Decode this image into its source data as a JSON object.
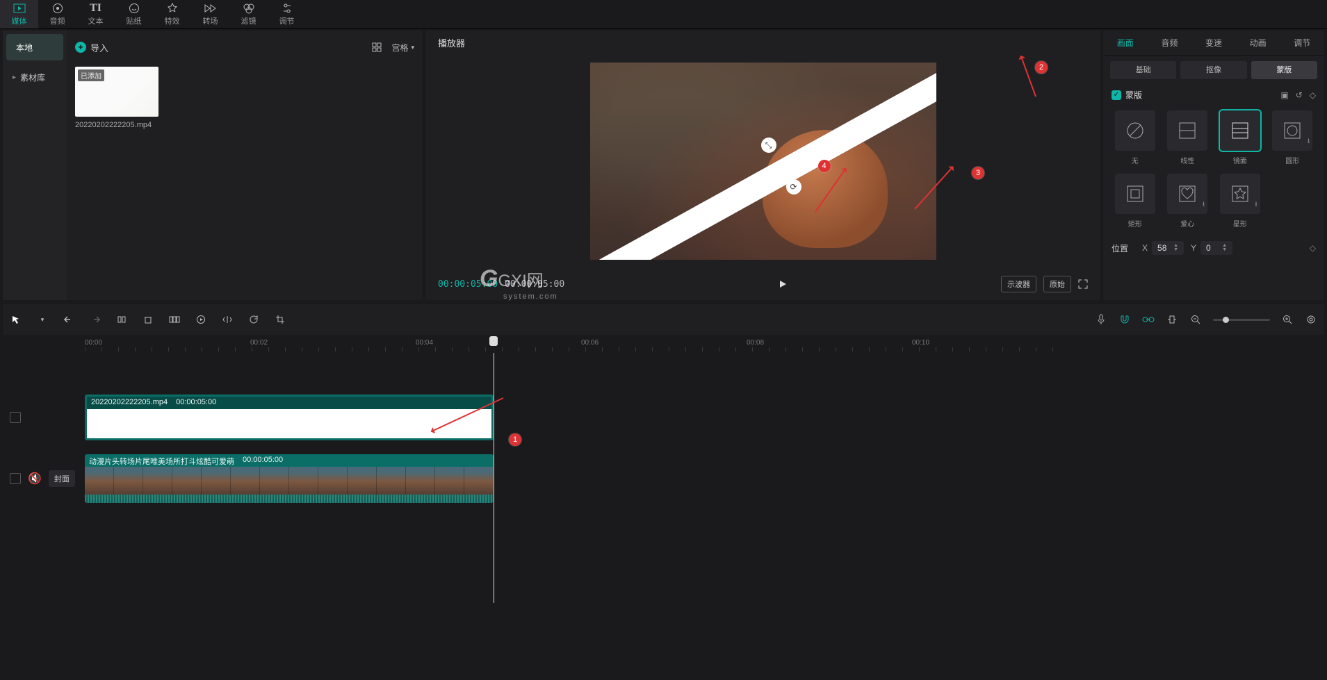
{
  "top_nav": {
    "items": [
      {
        "label": "媒体",
        "icon": "media"
      },
      {
        "label": "音频",
        "icon": "audio"
      },
      {
        "label": "文本",
        "icon": "text"
      },
      {
        "label": "贴纸",
        "icon": "sticker"
      },
      {
        "label": "特效",
        "icon": "effect"
      },
      {
        "label": "转场",
        "icon": "transition"
      },
      {
        "label": "滤镜",
        "icon": "filter"
      },
      {
        "label": "调节",
        "icon": "adjust"
      }
    ],
    "active": 0
  },
  "media_panel": {
    "sidebar": {
      "items": [
        {
          "label": "本地"
        },
        {
          "label": "素材库"
        }
      ],
      "active": 0
    },
    "import_label": "导入",
    "view_label": "宫格",
    "thumb": {
      "badge": "已添加",
      "name": "20220202222205.mp4"
    }
  },
  "player": {
    "title": "播放器",
    "time_current": "00:00:05:00",
    "time_total": "00:00:05:00",
    "scopes_label": "示波器",
    "original_label": "原始"
  },
  "inspector": {
    "tabs": [
      "画面",
      "音频",
      "变速",
      "动画",
      "调节"
    ],
    "active_tab": 0,
    "subtabs": [
      "基础",
      "抠像",
      "蒙版"
    ],
    "active_subtab": 2,
    "mask_title": "蒙版",
    "masks": [
      {
        "label": "无",
        "shape": "none"
      },
      {
        "label": "线性",
        "shape": "linear"
      },
      {
        "label": "镜面",
        "shape": "mirror",
        "selected": true
      },
      {
        "label": "圆形",
        "shape": "circle",
        "dl": true
      },
      {
        "label": "矩形",
        "shape": "rect"
      },
      {
        "label": "爱心",
        "shape": "heart",
        "dl": true
      },
      {
        "label": "星形",
        "shape": "star",
        "dl": true
      }
    ],
    "position": {
      "label": "位置",
      "x_label": "X",
      "x_value": "58",
      "y_label": "Y",
      "y_value": "0"
    }
  },
  "timeline": {
    "ruler_ticks": [
      "00:00",
      "00:02",
      "00:04",
      "00:06",
      "00:08",
      "00:10"
    ],
    "clip1": {
      "name": "20220202222205.mp4",
      "dur": "00:00:05:00"
    },
    "clip2": {
      "name": "动漫片头转场片尾唯美场所打斗炫酷可爱萌",
      "dur": "00:00:05:00"
    },
    "cover_label": "封面"
  },
  "annotations": {
    "a1": "1",
    "a2": "2",
    "a3": "3",
    "a4": "4"
  },
  "watermark": {
    "brand": "GXI网",
    "sub": "system.com"
  }
}
